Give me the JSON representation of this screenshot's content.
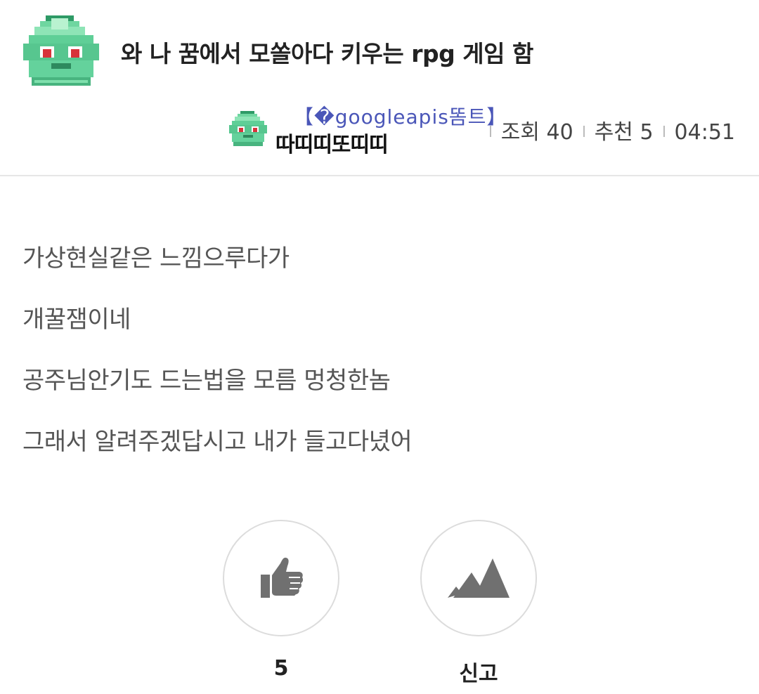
{
  "post": {
    "title": "와 나 꿈에서 모쏠아다 키우는 rpg 게임 함",
    "board_icon": "bulbasaur-pixel-icon",
    "author": {
      "tag": "【�googleapis똠트】",
      "name": "따띠띠또띠띠",
      "icon": "bulbasaur-pixel-icon"
    },
    "stats": {
      "views": "조회 40",
      "recommends": "추천 5",
      "time": "04:51"
    },
    "lines": [
      "가상현실같은 느낌으루다가",
      "개꿀잼이네",
      "공주님안기도 드는법을 모름 멍청한놈",
      "그래서 알려주겠답시고 내가 들고다녔어"
    ]
  },
  "actions": {
    "like_count": "5",
    "like_icon": "thumbs-up-icon",
    "report_label": "신고",
    "report_icon": "mountain-report-icon"
  },
  "colors": {
    "accent_tag": "#4a56b8",
    "icon_green": "#3bb783",
    "icon_gray": "#707070"
  }
}
